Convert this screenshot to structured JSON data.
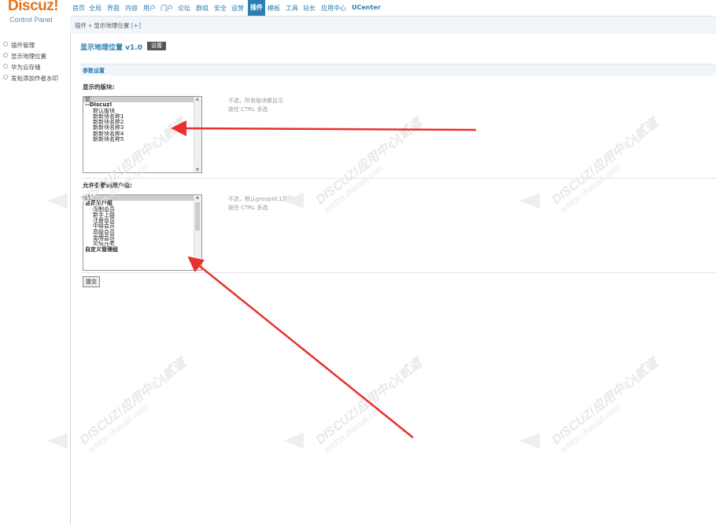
{
  "brand": {
    "logo": "Discuz!",
    "subtitle": "Control Panel"
  },
  "topnav": [
    "首页",
    "全局",
    "界面",
    "内容",
    "用户",
    "门户",
    "论坛",
    "群组",
    "安全",
    "运营",
    "插件",
    "模板",
    "工具",
    "站长",
    "应用中心",
    "UCenter"
  ],
  "topnav_active": "插件",
  "breadcrumb": {
    "text": "插件 » 显示地理位置",
    "plus": "[+]"
  },
  "sidebar": {
    "items": [
      "插件管理",
      "显示地理位置",
      "华为云存储",
      "发帖添加作者水印"
    ]
  },
  "main": {
    "title": "显示地理位置 v1.0",
    "settings_button": "设置",
    "section_title": "参数设置",
    "block_label": "显示的版块:",
    "block_options": [
      "空",
      "--Discuz!",
      "默认版块",
      "新新块名称1",
      "新新块名称2",
      "新新块名称3",
      "新新块名称4",
      "新新块名称5"
    ],
    "block_hint_1": "不选，所有版块都显示",
    "block_hint_2": "按住 CTRL 多选",
    "group_label": "允许查看的用户组:",
    "group_options": [
      "空",
      "会员用户组",
      "限制会员",
      "新手上路",
      "注册会员",
      "中级会员",
      "高级会员",
      "金牌会员",
      "论坛元老",
      "自定义管理组"
    ],
    "group_hint_1": "不选，默认groupid:1显示",
    "group_hint_2": "按住 CTRL 多选",
    "submit": "提交"
  },
  "watermark": {
    "line1": "DISCUZ!应用中心|贰道",
    "line2": "addon.dismall.com"
  },
  "colors": {
    "accent": "#2a7eb0",
    "logo": "#e5731b",
    "arrow": "#e8302c"
  }
}
